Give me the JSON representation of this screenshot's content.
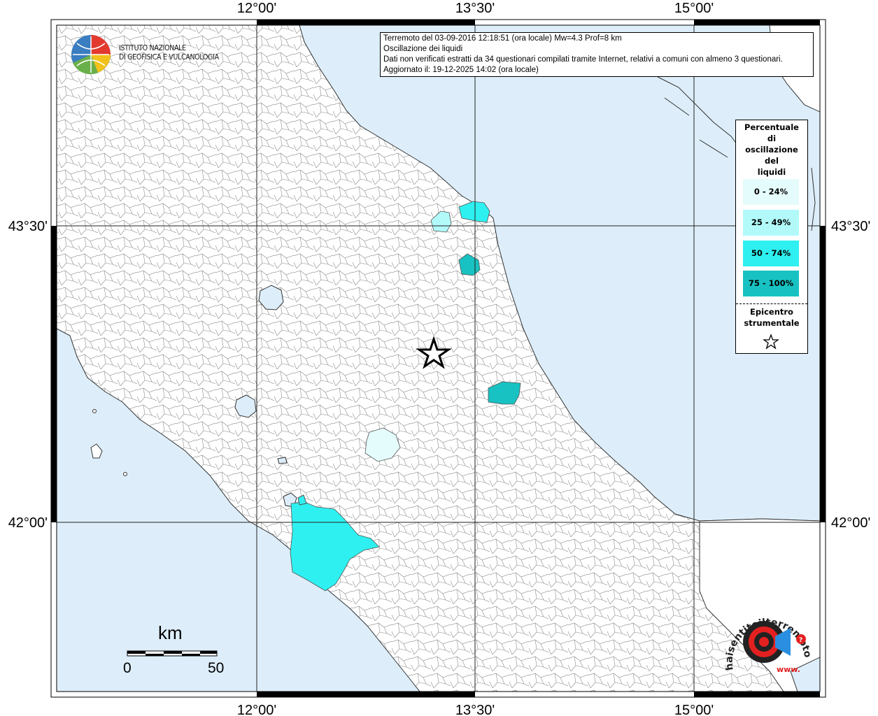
{
  "header": {
    "line1": "Terremoto del 03-09-2016 12:18:51 (ora locale) Mw=4.3 Prof=8 km",
    "line2": "Oscillazione dei liquidi",
    "line3": "Dati non verificati estratti da 34 questionari compilati tramite Internet, relativi a comuni con almeno 3 questionari.",
    "line4": "Aggiornato il: 19-12-2025 14:02 (ora locale)"
  },
  "axes": {
    "top": [
      "12°00'",
      "13°30'",
      "15°00'"
    ],
    "bottom": [
      "12°00'",
      "13°30'",
      "15°00'"
    ],
    "left": [
      "43°30'",
      "42°00'"
    ],
    "right": [
      "43°30'",
      "42°00'"
    ]
  },
  "logo": {
    "line1": "ISTITUTO NAZIONALE",
    "line2": "DI GEOFISICA E VULCANOLOGIA"
  },
  "legend": {
    "title": [
      "Percentuale",
      "di",
      "oscillazione",
      "del",
      "liquidi"
    ],
    "items": [
      {
        "label": "0 - 24%",
        "color": "#e5fcfc"
      },
      {
        "label": "25 - 49%",
        "color": "#b2fafa"
      },
      {
        "label": "50 - 74%",
        "color": "#2ef0f0"
      },
      {
        "label": "75 - 100%",
        "color": "#18c2c2"
      }
    ],
    "epicenter_title": [
      "Epicentro",
      "strumentale"
    ]
  },
  "scale": {
    "title": "km",
    "min": "0",
    "max": "50"
  },
  "colors": {
    "sea": "#ddeefa",
    "land": "#ffffff",
    "border": "#555555"
  },
  "watermark": {
    "text": "haisentitoilterremoto.it",
    "url": "www."
  }
}
